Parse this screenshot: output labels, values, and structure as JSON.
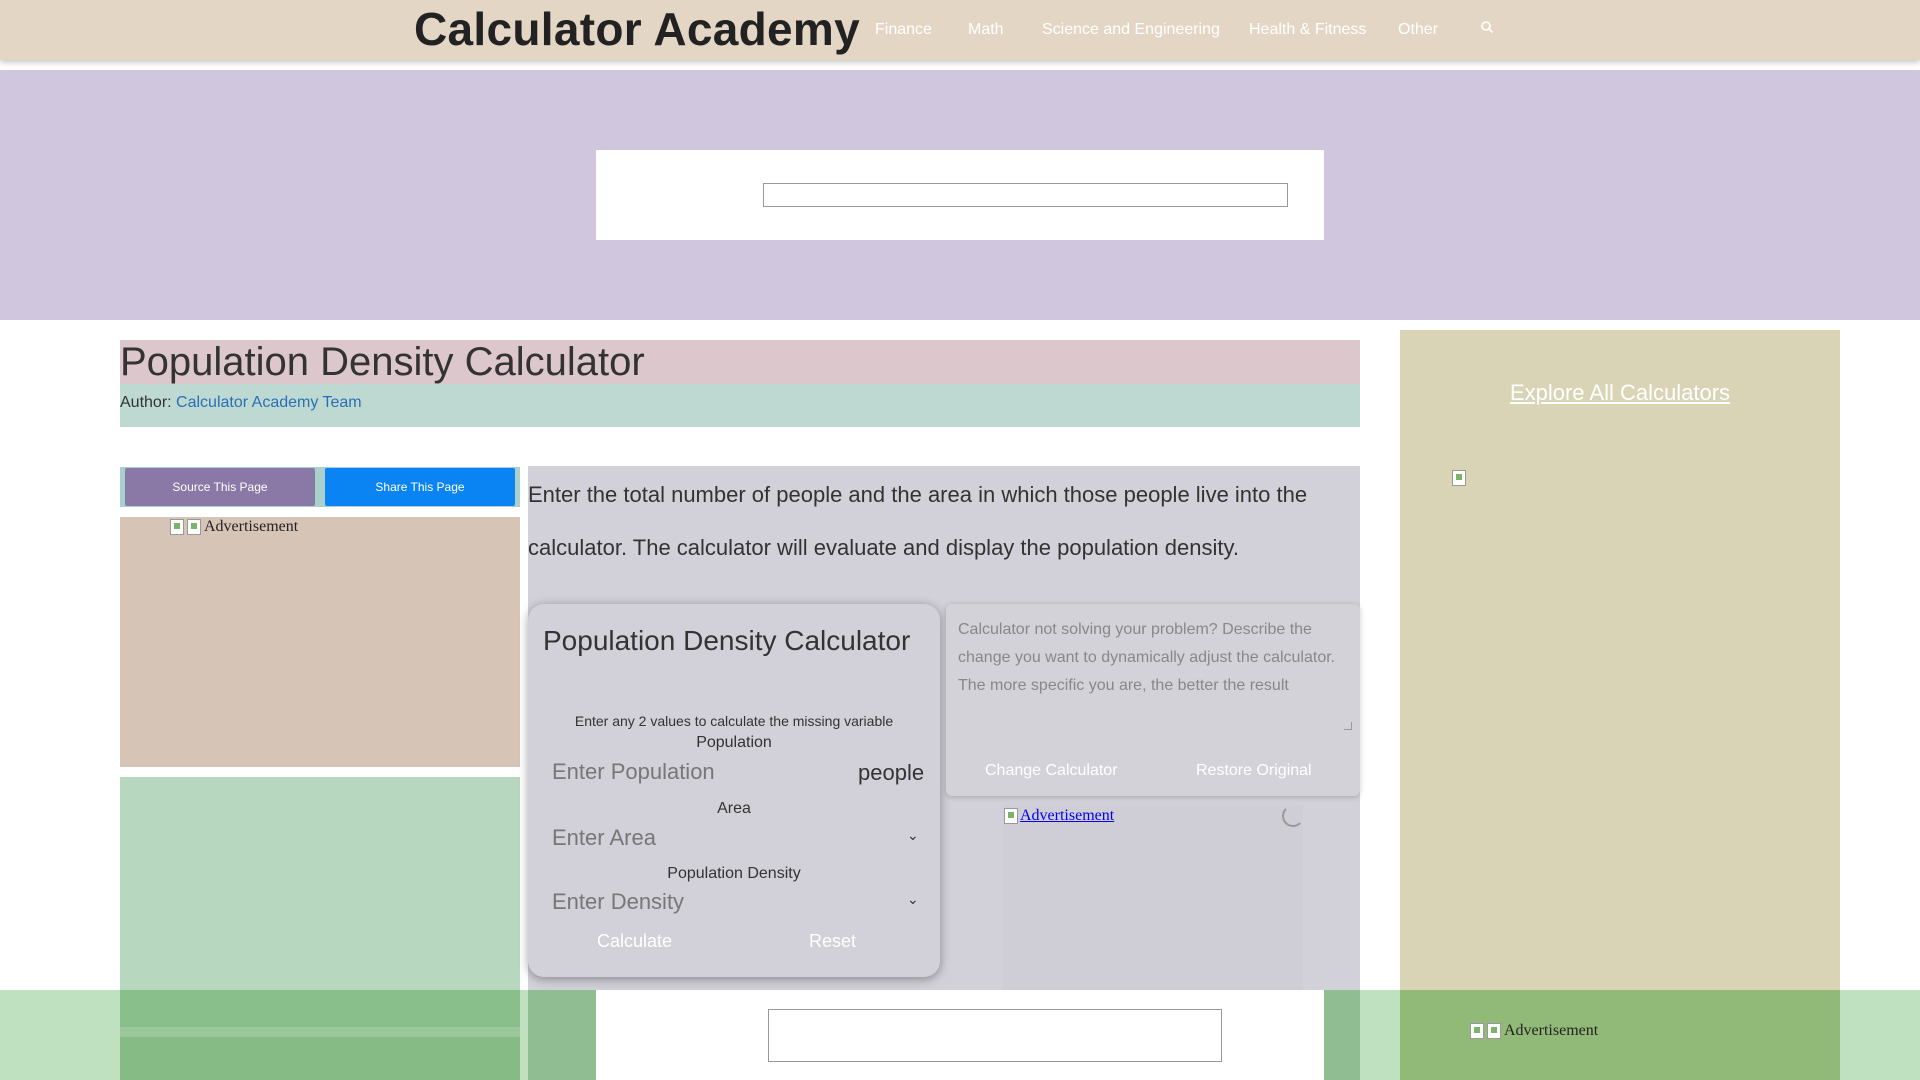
{
  "header": {
    "logo": "Calculator Academy",
    "nav": [
      "Finance",
      "Math",
      "Science and Engineering",
      "Health & Fitness",
      "Other"
    ],
    "search_icon": "search-icon"
  },
  "page": {
    "title": "Population Density Calculator",
    "author_label": "Author:",
    "author_name": "Calculator Academy Team"
  },
  "share": {
    "source_label": "Source This Page",
    "share_label": "Share This Page"
  },
  "ads": {
    "alt_text": "Advertisement"
  },
  "intro": "Enter the total number of people and the area in which those people live into the calculator. The calculator will evaluate and display the population density.",
  "calculator": {
    "title": "Population Density Calculator",
    "subtitle": "Enter any 2 values to calculate the missing variable",
    "fields": [
      {
        "label": "Population",
        "placeholder": "Enter Population",
        "unit": "people"
      },
      {
        "label": "Area",
        "placeholder": "Enter Area"
      },
      {
        "label": "Population Density",
        "placeholder": "Enter Density"
      }
    ],
    "calculate_label": "Calculate",
    "reset_label": "Reset"
  },
  "ai_panel": {
    "placeholder": "Calculator not solving your problem? Describe the change you want to dynamically adjust the calculator. The more specific you are, the better the result",
    "change_label": "Change Calculator",
    "restore_label": "Restore Original"
  },
  "sidebar": {
    "explore_label": "Explore All Calculators"
  },
  "colors": {
    "header_bg": "#e4d6c4",
    "source_btn": "#8a78a6",
    "share_btn": "#0a84f2",
    "author_link": "#2a6fb5"
  }
}
